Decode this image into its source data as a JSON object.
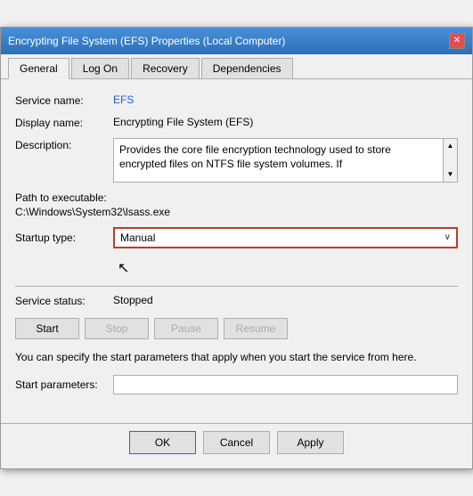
{
  "window": {
    "title": "Encrypting File System (EFS) Properties (Local Computer)"
  },
  "titlebar": {
    "close_label": "✕"
  },
  "tabs": [
    {
      "id": "general",
      "label": "General",
      "active": true
    },
    {
      "id": "logon",
      "label": "Log On",
      "active": false
    },
    {
      "id": "recovery",
      "label": "Recovery",
      "active": false
    },
    {
      "id": "dependencies",
      "label": "Dependencies",
      "active": false
    }
  ],
  "fields": {
    "service_name_label": "Service name:",
    "service_name_value": "EFS",
    "display_name_label": "Display name:",
    "display_name_value": "Encrypting File System (EFS)",
    "description_label": "Description:",
    "description_value": "Provides the core file encryption technology used to store encrypted files on NTFS file system volumes. If",
    "path_label": "Path to executable:",
    "path_value": "C:\\Windows\\System32\\lsass.exe",
    "startup_type_label": "Startup type:",
    "startup_type_value": "Manual"
  },
  "service_status": {
    "label": "Service status:",
    "value": "Stopped"
  },
  "buttons": {
    "start": "Start",
    "stop": "Stop",
    "pause": "Pause",
    "resume": "Resume"
  },
  "note": {
    "text": "You can specify the start parameters that apply when you start the service from here."
  },
  "start_params": {
    "label": "Start parameters:",
    "placeholder": ""
  },
  "footer": {
    "ok": "OK",
    "cancel": "Cancel",
    "apply": "Apply"
  }
}
